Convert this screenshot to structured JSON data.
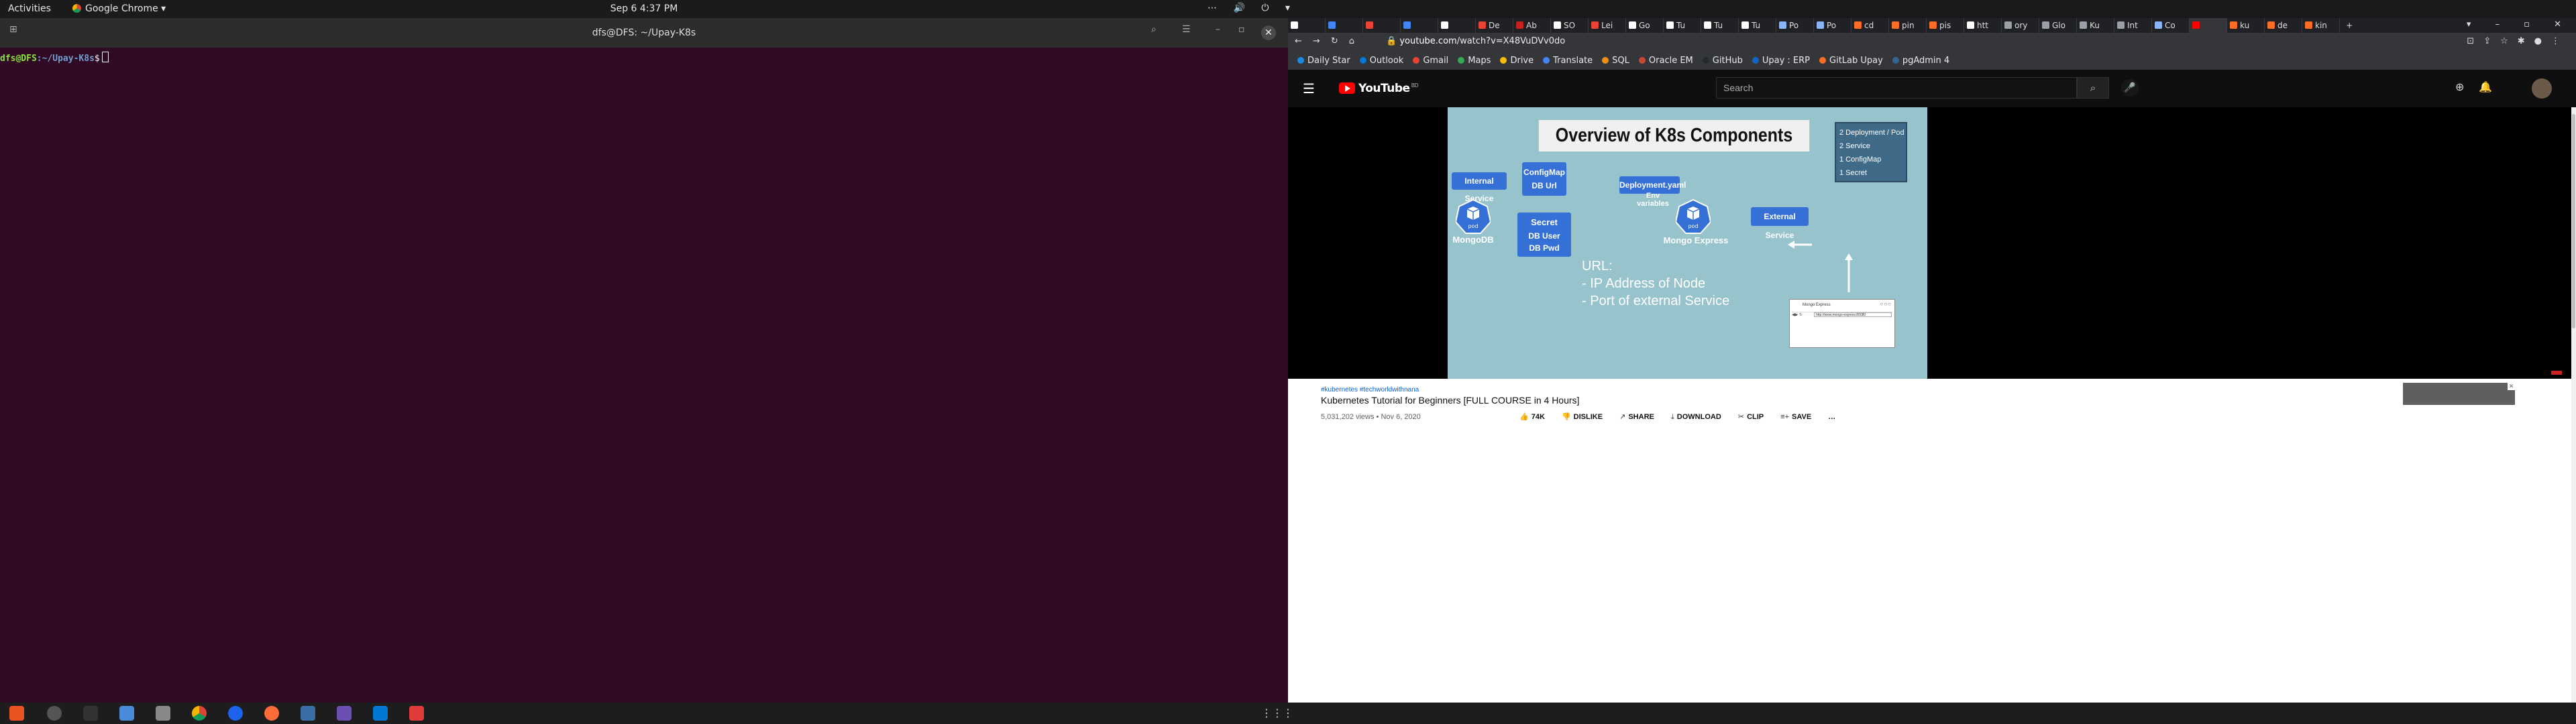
{
  "topbar": {
    "activities": "Activities",
    "app_name": "Google Chrome ▾",
    "clock": "Sep 6   4:37 PM",
    "tray": "⋯ 🔊 ⏻ ▾"
  },
  "terminal": {
    "title": "dfs@DFS: ~/Upay-K8s",
    "prompt_user": "dfs@DFS",
    "prompt_path": ":~/Upay-K8s",
    "prompt_symbol": "$"
  },
  "browser": {
    "tabs": [
      {
        "label": "",
        "color": "#ffffff"
      },
      {
        "label": "",
        "color": "#4285f4"
      },
      {
        "label": "",
        "color": "#ea4335"
      },
      {
        "label": "",
        "color": "#4285f4"
      },
      {
        "label": "",
        "color": "#ffffff"
      },
      {
        "label": "De",
        "color": "#ea4335"
      },
      {
        "label": "Ab",
        "color": "#c5221f"
      },
      {
        "label": "SO",
        "color": "#ffffff"
      },
      {
        "label": "Lei",
        "color": "#ea4335"
      },
      {
        "label": "Go",
        "color": "#ffffff"
      },
      {
        "label": "Tu",
        "color": "#ffffff"
      },
      {
        "label": "Tu",
        "color": "#ffffff"
      },
      {
        "label": "Tu",
        "color": "#ffffff"
      },
      {
        "label": "Po",
        "color": "#8ab4f8"
      },
      {
        "label": "Po",
        "color": "#8ab4f8"
      },
      {
        "label": "cd",
        "color": "#fc6d26"
      },
      {
        "label": "pin",
        "color": "#fc6d26"
      },
      {
        "label": "pis",
        "color": "#fc6d26"
      },
      {
        "label": "htt",
        "color": "#ffffff"
      },
      {
        "label": "ory",
        "color": "#9aa0a6"
      },
      {
        "label": "Glo",
        "color": "#9aa0a6"
      },
      {
        "label": "Ku",
        "color": "#9aa0a6"
      },
      {
        "label": "Int",
        "color": "#9aa0a6"
      },
      {
        "label": "Co",
        "color": "#8ab4f8"
      },
      {
        "label": "",
        "color": "#ff0000",
        "active": true
      },
      {
        "label": "ku",
        "color": "#fc6d26"
      },
      {
        "label": "de",
        "color": "#fc6d26"
      },
      {
        "label": "kin",
        "color": "#fc6d26"
      }
    ],
    "new_tab": "+",
    "window_controls": "▾ – ▫ ✕",
    "url_host": "youtube.com",
    "url_path": "/watch?v=X48VuDVv0do",
    "bookmarks": [
      {
        "label": "Daily Star",
        "color": "#1e88e5"
      },
      {
        "label": "Outlook",
        "color": "#0078d4"
      },
      {
        "label": "Gmail",
        "color": "#ea4335"
      },
      {
        "label": "Maps",
        "color": "#34a853"
      },
      {
        "label": "Drive",
        "color": "#fbbc04"
      },
      {
        "label": "Translate",
        "color": "#4285f4"
      },
      {
        "label": "SQL",
        "color": "#f29111"
      },
      {
        "label": "Oracle EM",
        "color": "#c74634"
      },
      {
        "label": "GitHub",
        "color": "#24292e"
      },
      {
        "label": "Upay : ERP",
        "color": "#1565c0"
      },
      {
        "label": "GitLab Upay",
        "color": "#fc6d26"
      },
      {
        "label": "pgAdmin 4",
        "color": "#336791"
      }
    ]
  },
  "youtube": {
    "logo_text": "YouTube",
    "logo_region": "BD",
    "search_placeholder": "Search",
    "slide": {
      "title": "Overview of K8s Components",
      "counts": [
        "2 Deployment / Pod",
        "2 Service",
        "1 ConfigMap",
        "1 Secret"
      ],
      "internal_service": "Internal Service",
      "configmap_title": "ConfigMap",
      "configmap_sub": "DB Url",
      "secret_title": "Secret",
      "secret_line1": "DB User",
      "secret_line2": "DB Pwd",
      "deployment": "Deployment.yaml",
      "env": "Env\nvariables",
      "pod_label": "pod",
      "mongodb": "MongoDB",
      "mongo_express": "Mongo Express",
      "external_service": "External Service",
      "url_line1": "URL:",
      "url_line2": "- IP Address of Node",
      "url_line3": "- Port of external Service",
      "mini_browser_title": "Mongo Express",
      "mini_browser_url": "http://www.mongo-express:80080"
    },
    "video": {
      "tags": "#kubernetes #techworldwithnana",
      "title": "Kubernetes Tutorial for Beginners [FULL COURSE in 4 Hours]",
      "meta": "5,031,202 views • Nov 6, 2020",
      "like_count": "74K",
      "dislike": "DISLIKE",
      "share": "SHARE",
      "download": "DOWNLOAD",
      "clip": "CLIP",
      "save": "SAVE",
      "more": "…"
    }
  }
}
